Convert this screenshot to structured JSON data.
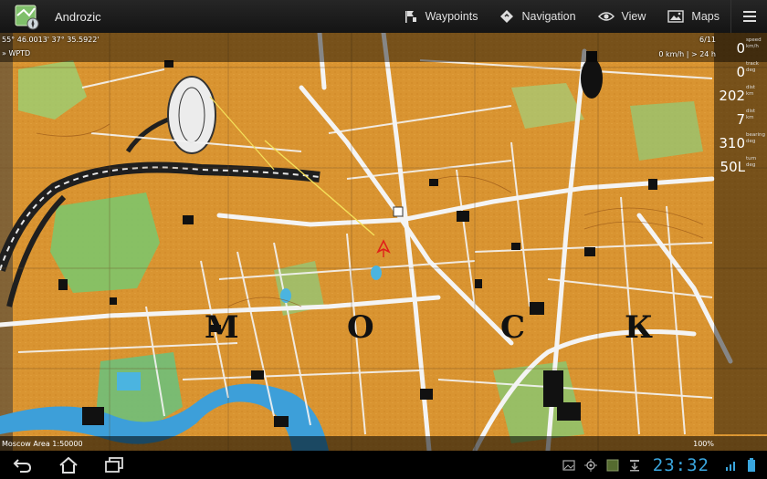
{
  "app": {
    "title": "Androzic",
    "icon": "map-app-icon"
  },
  "actions": [
    {
      "label": "Waypoints",
      "icon": "waypoint-flag-icon"
    },
    {
      "label": "Navigation",
      "icon": "navigation-diamond-icon"
    },
    {
      "label": "View",
      "icon": "eye-icon"
    },
    {
      "label": "Maps",
      "icon": "map-image-icon"
    }
  ],
  "overflow_icon": "overflow-menu-icon",
  "map_overlay": {
    "coordinates": "55° 46.0013' 37° 35.5922'",
    "waypoint": "» WPTD",
    "track_count": "6/11",
    "speed_info": "0 km/h | > 24 h",
    "map_name": "Moscow Area 1:50000",
    "zoom": "100%",
    "map_labels": {
      "m": "М",
      "o": "О",
      "c": "С",
      "k": "К"
    }
  },
  "gauges": [
    {
      "value": "0",
      "unit_top": "speed",
      "unit_bottom": "km/h"
    },
    {
      "value": "0",
      "unit_top": "track",
      "unit_bottom": "deg"
    },
    {
      "value": "202",
      "unit_top": "dist",
      "unit_bottom": "km"
    },
    {
      "value": "7",
      "unit_top": "dist",
      "unit_bottom": "km"
    },
    {
      "value": "310",
      "unit_top": "bearing",
      "unit_bottom": "deg"
    },
    {
      "value": "50L",
      "unit_top": "turn",
      "unit_bottom": "deg"
    }
  ],
  "system": {
    "clock": "23:32",
    "nav_icons": [
      "back-icon",
      "home-icon",
      "recent-apps-icon"
    ],
    "colors": {
      "clock": "#3aa6de",
      "map_base": "#d8902d"
    }
  }
}
